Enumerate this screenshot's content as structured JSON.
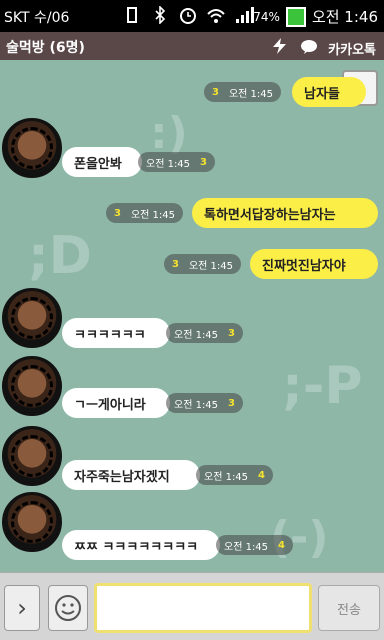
{
  "status_bar": {
    "carrier": "SKT",
    "date": "수/06",
    "battery_percent": "74%",
    "time": "오전 1:46"
  },
  "header": {
    "room_title": "술먹방 (6명)",
    "brand": "카카오톡"
  },
  "background_emoticons": [
    ":)",
    ";D",
    ";-P",
    "(-)"
  ],
  "messages": [
    {
      "dir": "out",
      "text": "남자들",
      "time": "오전 1:45",
      "unread": "3"
    },
    {
      "dir": "in",
      "text": "폰을안봐",
      "time": "오전 1:45",
      "unread": "3"
    },
    {
      "dir": "out",
      "text": "톡하면서답장하는남자는",
      "time": "오전 1:45",
      "unread": "3"
    },
    {
      "dir": "out",
      "text": "진짜멋진남자야",
      "time": "오전 1:45",
      "unread": "3"
    },
    {
      "dir": "in",
      "text": "ㅋㅋㅋㅋㅋㅋ",
      "time": "오전 1:45",
      "unread": "3"
    },
    {
      "dir": "in",
      "text": "ㄱㅡ게아니라",
      "time": "오전 1:45",
      "unread": "3"
    },
    {
      "dir": "in",
      "text": "자주죽는남자겠지",
      "time": "오전 1:45",
      "unread": "4"
    },
    {
      "dir": "in",
      "text": "ㅉㅉ ㅋㅋㅋㅋㅋㅋㅋㅋ",
      "time": "오전 1:45",
      "unread": "4"
    }
  ],
  "input": {
    "value": "",
    "send_label": "전송"
  }
}
